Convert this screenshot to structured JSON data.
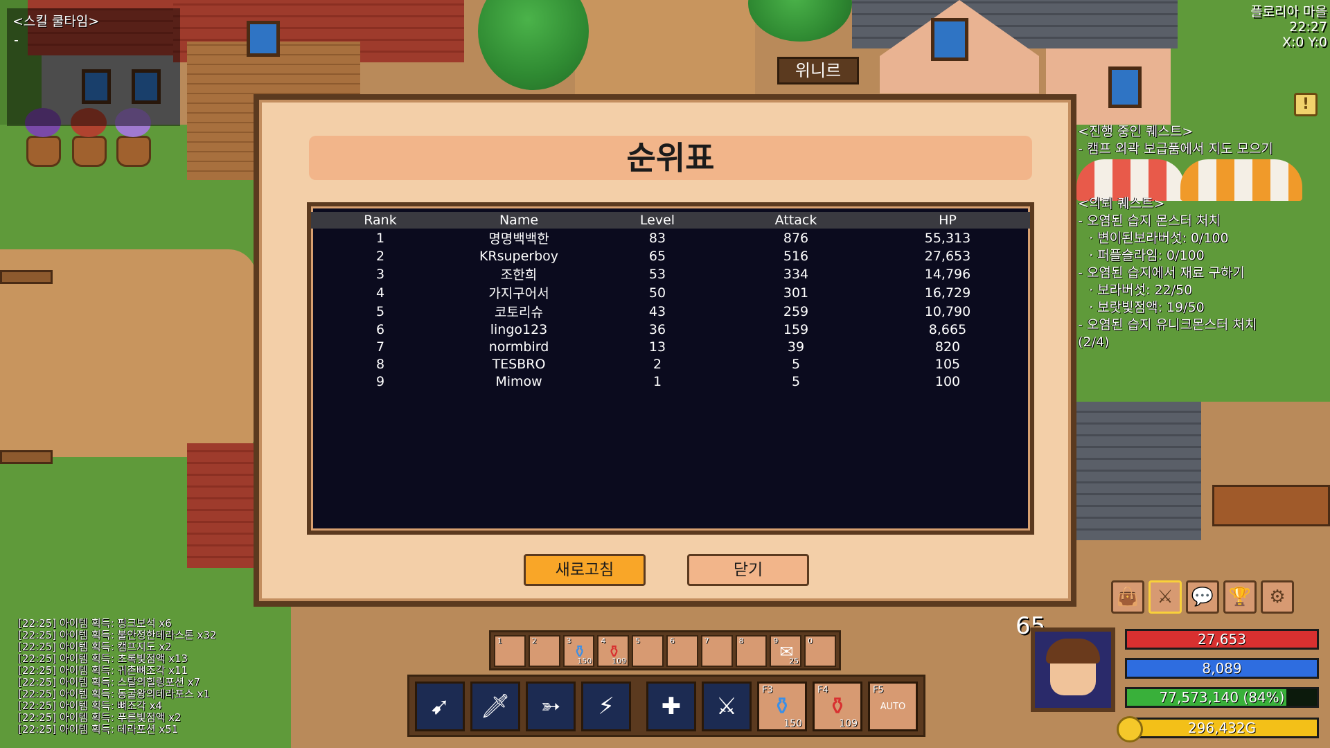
{
  "hud": {
    "skill_cooldown_title": "<스킬 쿨타임>",
    "skill_cooldown_value": "-",
    "location_name": "플로리아 마을",
    "clock": "22:27",
    "coords": "X:0 Y:0",
    "quest_alert_icon": "exclamation-icon",
    "sign_text": "위니르"
  },
  "quests": {
    "active_title": "<진행 중인 퀘스트>",
    "active_items": [
      "- 캠프 외곽 보급품에서 지도 모으기"
    ],
    "request_title": "<의뢰 퀘스트>",
    "request_groups": [
      {
        "title": "- 오염된 습지 몬스터 처치",
        "subs": [
          "· 변이된보라버섯: 0/100",
          "· 퍼플슬라임: 0/100"
        ]
      },
      {
        "title": "- 오염된 습지에서 재료 구하기",
        "subs": [
          "· 보라버섯: 22/50",
          "· 보랏빛점액: 19/50"
        ]
      },
      {
        "title": "- 오염된 습지 유니크몬스터 처치",
        "subs": [
          "(2/4)"
        ]
      }
    ]
  },
  "ranking": {
    "title": "순위표",
    "columns": [
      "Rank",
      "Name",
      "Level",
      "Attack",
      "HP"
    ],
    "rows": [
      [
        "1",
        "명명백백한",
        "83",
        "876",
        "55,313"
      ],
      [
        "2",
        "KRsuperboy",
        "65",
        "516",
        "27,653"
      ],
      [
        "3",
        "조한희",
        "53",
        "334",
        "14,796"
      ],
      [
        "4",
        "가지구어서",
        "50",
        "301",
        "16,729"
      ],
      [
        "5",
        "코토리슈",
        "43",
        "259",
        "10,790"
      ],
      [
        "6",
        "lingo123",
        "36",
        "159",
        "8,665"
      ],
      [
        "7",
        "normbird",
        "13",
        "39",
        "820"
      ],
      [
        "8",
        "TESBRO",
        "2",
        "5",
        "105"
      ],
      [
        "9",
        "Mimow",
        "1",
        "5",
        "100"
      ]
    ],
    "refresh_label": "새로고침",
    "close_label": "닫기"
  },
  "quickbar": [
    {
      "num": "1",
      "icon": "",
      "count": ""
    },
    {
      "num": "2",
      "icon": "",
      "count": ""
    },
    {
      "num": "3",
      "icon": "blue-potion-icon",
      "count": "150"
    },
    {
      "num": "4",
      "icon": "red-potion-icon",
      "count": "109"
    },
    {
      "num": "5",
      "icon": "",
      "count": ""
    },
    {
      "num": "6",
      "icon": "",
      "count": ""
    },
    {
      "num": "7",
      "icon": "",
      "count": ""
    },
    {
      "num": "8",
      "icon": "",
      "count": ""
    },
    {
      "num": "9",
      "icon": "scroll-icon",
      "count": "25"
    },
    {
      "num": "0",
      "icon": "",
      "count": ""
    }
  ],
  "skillbar": {
    "skills": [
      {
        "icon": "spear-skill-icon",
        "key": ""
      },
      {
        "icon": "sword-skill-icon",
        "key": ""
      },
      {
        "icon": "arrow-burst-skill-icon",
        "key": ""
      },
      {
        "icon": "lightning-skill-icon",
        "key": ""
      },
      {
        "icon": "heal-skill-icon",
        "key": ""
      },
      {
        "icon": "blade-skill-icon",
        "key": ""
      }
    ],
    "items": [
      {
        "key": "F3",
        "icon": "blue-potion-icon",
        "count": "150"
      },
      {
        "key": "F4",
        "icon": "red-potion-icon",
        "count": "109"
      },
      {
        "key": "F5",
        "icon": "auto-icon",
        "label": "AUTO"
      }
    ]
  },
  "menu_icons": [
    "bag-icon",
    "swords-icon",
    "chat-icon",
    "trophy-icon",
    "gear-icon"
  ],
  "player": {
    "level": "65",
    "hp": "27,653",
    "mp": "8,089",
    "exp": "77,573,140 (84%)",
    "exp_fraction": 0.84,
    "gold": "296,432G"
  },
  "chat_log": [
    "[22:25] 아이템 획득: 핑크보석 x6",
    "[22:25] 아이템 획득: 불안정한테라스톤 x32",
    "[22:25] 아이템 획득: 캠프지도 x2",
    "[22:25] 아이템 획득: 초록빛점액 x13",
    "[22:25] 아이템 획득: 귀촌뼈조각 x11",
    "[22:25] 아이템 획득: 스탈의힐링포션 x7",
    "[22:25] 아이템 획득: 동굴왕의테라포스 x1",
    "[22:25] 아이템 획득: 뼈조각 x4",
    "[22:25] 아이템 획득: 푸른빛점액 x2",
    "[22:25] 아이템 획득: 테라포션 x51"
  ],
  "colors": {
    "modal_bg": "#f3cfa8",
    "frame_brown": "#5b3a1f",
    "refresh_button": "#f9a628",
    "hp": "#d83030",
    "mp": "#2e6de0",
    "exp": "#39b03a",
    "gold": "#f3c018"
  }
}
